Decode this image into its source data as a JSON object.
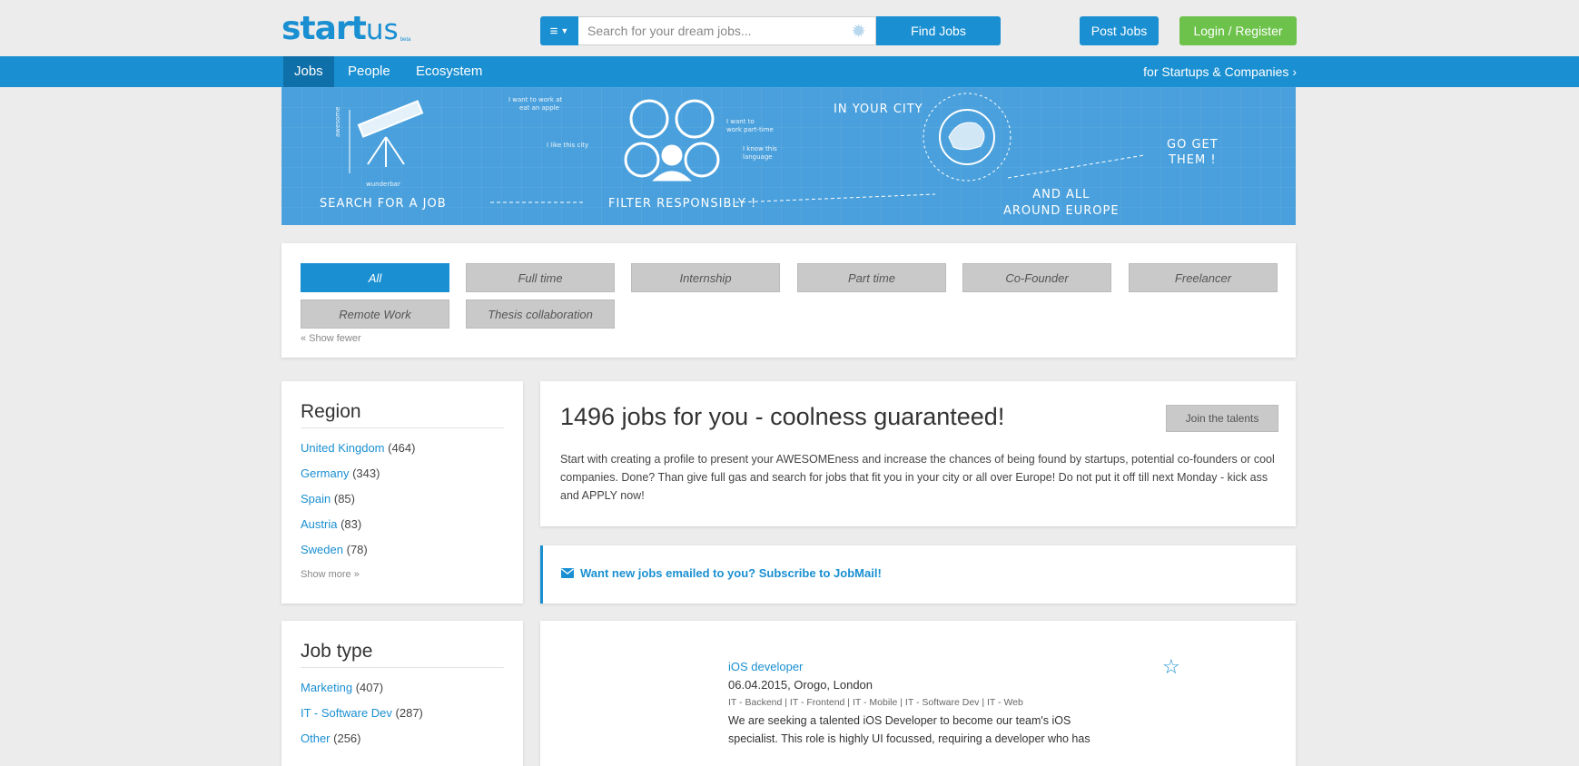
{
  "header": {
    "logo_bold": "start",
    "logo_thin": "us",
    "logo_tiny": "beta",
    "search_placeholder": "Search for your dream jobs...",
    "find_label": "Find Jobs",
    "post_label": "Post Jobs",
    "login_label": "Login / Register"
  },
  "nav": {
    "items": [
      "Jobs",
      "People",
      "Ecosystem"
    ],
    "startups_link": "for Startups & Companies ›"
  },
  "banner": {
    "search": "SEARCH FOR A JOB",
    "filter": "FILTER RESPONSIBLY !",
    "city": "IN YOUR CITY",
    "europe_line1": "AND ALL",
    "europe_line2": "AROUND EUROPE",
    "goget_line1": "GO GET",
    "goget_line2": "THEM !",
    "note_apple_1": "I want to work at",
    "note_apple_2": "eat an apple",
    "note_parttime_1": "I want to",
    "note_parttime_2": "work part-time",
    "note_city": "I like this city",
    "note_language_1": "I know this",
    "note_language_2": "language",
    "note_awesome": "awesome",
    "note_wunderbar": "wunderbar"
  },
  "filters": {
    "tags": [
      "All",
      "Full time",
      "Internship",
      "Part time",
      "Co-Founder",
      "Freelancer",
      "Remote Work",
      "Thesis collaboration"
    ],
    "show_fewer": "« Show fewer"
  },
  "region": {
    "title": "Region",
    "items": [
      {
        "name": "United Kingdom",
        "count": "(464)"
      },
      {
        "name": "Germany",
        "count": "(343)"
      },
      {
        "name": "Spain",
        "count": "(85)"
      },
      {
        "name": "Austria",
        "count": "(83)"
      },
      {
        "name": "Sweden",
        "count": "(78)"
      }
    ],
    "show_more": "Show more »"
  },
  "job_type": {
    "title": "Job type",
    "items": [
      {
        "name": "Marketing",
        "count": "(407)"
      },
      {
        "name": "IT - Software Dev",
        "count": "(287)"
      },
      {
        "name": "Other",
        "count": "(256)"
      }
    ]
  },
  "intro": {
    "title": "1496 jobs for you - coolness guaranteed!",
    "join_label": "Join the talents",
    "text": "Start with creating a profile to present your AWESOMEness and increase the chances of being found by startups, potential co-founders or cool companies. Done? Than give full gas and search for jobs that fit you in your city or all over Europe! Do not put it off till next Monday - kick ass and APPLY now!"
  },
  "jobmail": {
    "label": "Want new jobs emailed to you? Subscribe to JobMail!"
  },
  "job": {
    "title": "iOS developer",
    "meta": "06.04.2015, Orogo, London",
    "tags": "IT - Backend | IT - Frontend | IT - Mobile | IT - Software Dev | IT - Web",
    "desc": "We are seeking a talented iOS Developer to become our team's iOS specialist. This role is highly UI focussed, requiring a developer who has"
  },
  "colors": {
    "brand_blue": "#1a8fd1",
    "login_green": "#6cc24a",
    "banner_blue": "#4aa0dc"
  }
}
